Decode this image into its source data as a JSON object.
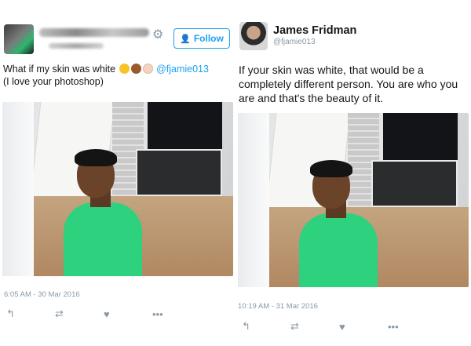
{
  "left": {
    "follow_label": "Follow",
    "tweet": {
      "text_before": "What if my skin was white ",
      "mention": "@fjamie013",
      "text_after": "(I love your photoshop)"
    },
    "emojis": [
      "laughing-face",
      "dark-skin-face",
      "light-skin-face"
    ],
    "timestamp": "6:05 AM - 30 Mar 2016",
    "actions": {
      "reply": "↰",
      "retweet": "⇄",
      "like": "♥",
      "more": "•••"
    }
  },
  "right": {
    "author_name": "James Fridman",
    "author_handle": "@fjamie013",
    "tweet_text": "If your skin was white, that would be a completely different person. You are who you are and that's the beauty of it.",
    "timestamp": "10:19 AM - 31 Mar 2016",
    "actions": {
      "reply": "↰",
      "retweet": "⇄",
      "like": "♥",
      "more": "•••"
    }
  },
  "colors": {
    "accent": "#1da1f2",
    "muted": "#8899a6",
    "text": "#14171a"
  }
}
